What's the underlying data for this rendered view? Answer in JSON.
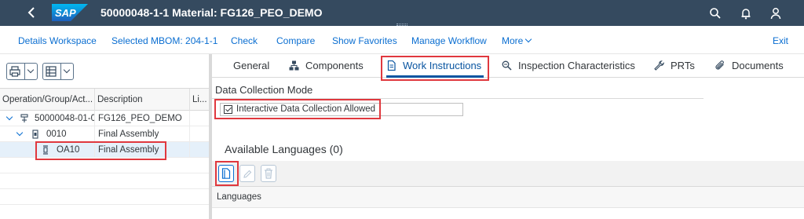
{
  "shell": {
    "title": "50000048-1-1 Material: FG126_PEO_DEMO",
    "logo_text": "SAP",
    "icons": [
      "back-icon",
      "search-icon",
      "bell-icon",
      "user-icon"
    ]
  },
  "toolbar": {
    "items": [
      "Details Workspace",
      "Selected MBOM: 204-1-1",
      "Check",
      "Compare",
      "Show Favorites",
      "Manage Workflow"
    ],
    "more": "More",
    "exit": "Exit"
  },
  "tree": {
    "columns": [
      "Operation/Group/Act...",
      "Description",
      "Li..."
    ],
    "rows": [
      {
        "id": "50000048-01-0",
        "description": "FG126_PEO_DEMO"
      },
      {
        "id": "0010",
        "description": "Final Assembly"
      },
      {
        "id": "OA10",
        "description": "Final Assembly"
      }
    ]
  },
  "tabs": [
    "General",
    "Components",
    "Work Instructions",
    "Inspection Characteristics",
    "PRTs",
    "Documents"
  ],
  "active_tab": "Work Instructions",
  "data_collection": {
    "title": "Data Collection Mode",
    "checkbox_label": "Interactive Data Collection Allowed",
    "checked": true
  },
  "languages": {
    "title": "Available Languages (0)",
    "column": "Languages"
  },
  "colors": {
    "shell": "#354a5f",
    "link": "#0a6ed1",
    "highlight": "#e0383e",
    "selected_row": "#e5f0fa"
  }
}
